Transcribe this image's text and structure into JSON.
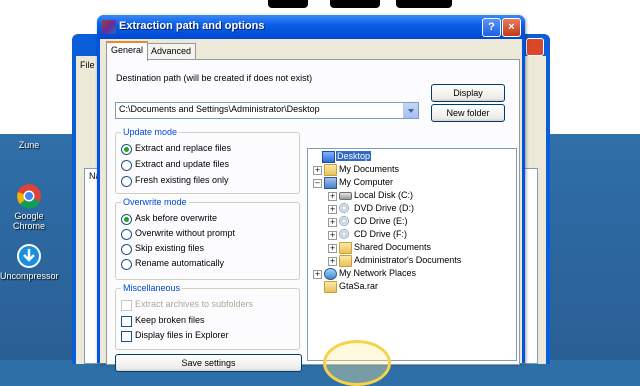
{
  "desktop": {
    "icons": [
      {
        "label": "Zune"
      },
      {
        "label": "Google Chrome"
      },
      {
        "label": "Uncompressor"
      }
    ]
  },
  "background_window": {
    "menu_first": "File",
    "list_header": "Na"
  },
  "dialog": {
    "title": "Extraction path and options",
    "help_button": "?",
    "close_button": "×",
    "tabs": [
      {
        "label": "General",
        "active": true
      },
      {
        "label": "Advanced",
        "active": false
      }
    ],
    "destination": {
      "label": "Destination path (will be created if does not exist)",
      "value": "C:\\Documents and Settings\\Administrator\\Desktop"
    },
    "buttons": {
      "display": "Display",
      "new_folder": "New folder",
      "save_settings": "Save settings"
    },
    "update_mode": {
      "title": "Update mode",
      "options": [
        {
          "label": "Extract and replace files",
          "selected": true
        },
        {
          "label": "Extract and update files",
          "selected": false
        },
        {
          "label": "Fresh existing files only",
          "selected": false
        }
      ]
    },
    "overwrite_mode": {
      "title": "Overwrite mode",
      "options": [
        {
          "label": "Ask before overwrite",
          "selected": true
        },
        {
          "label": "Overwrite without prompt",
          "selected": false
        },
        {
          "label": "Skip existing files",
          "selected": false
        },
        {
          "label": "Rename automatically",
          "selected": false
        }
      ]
    },
    "miscellaneous": {
      "title": "Miscellaneous",
      "options": [
        {
          "label": "Extract archives to subfolders",
          "checked": false,
          "disabled": true
        },
        {
          "label": "Keep broken files",
          "checked": false,
          "disabled": false
        },
        {
          "label": "Display files in Explorer",
          "checked": false,
          "disabled": false
        }
      ]
    },
    "tree": [
      {
        "label": "Desktop",
        "icon": "desktop-icon",
        "expander": "",
        "selected": true
      },
      {
        "label": "My Documents",
        "icon": "folder-icon",
        "expander": "+"
      },
      {
        "label": "My Computer",
        "icon": "computer-icon",
        "expander": "−"
      },
      {
        "label": "Local Disk (C:)",
        "icon": "drive-icon",
        "expander": "+"
      },
      {
        "label": "DVD Drive (D:)",
        "icon": "disc-icon",
        "expander": "+"
      },
      {
        "label": "CD Drive (E:)",
        "icon": "disc-icon",
        "expander": "+"
      },
      {
        "label": "CD Drive (F:)",
        "icon": "disc-icon",
        "expander": "+"
      },
      {
        "label": "Shared Documents",
        "icon": "folder-icon",
        "expander": "+"
      },
      {
        "label": "Administrator's Documents",
        "icon": "folder-icon",
        "expander": "+"
      },
      {
        "label": "My Network Places",
        "icon": "network-icon",
        "expander": "+"
      },
      {
        "label": "GtaSa.rar",
        "icon": "folder-icon",
        "expander": ""
      }
    ]
  },
  "colors": {
    "titlebar": "#0a5fe6",
    "dialog_face": "#ece9d8",
    "group_title": "#0046d5",
    "selection": "#316ac5"
  }
}
